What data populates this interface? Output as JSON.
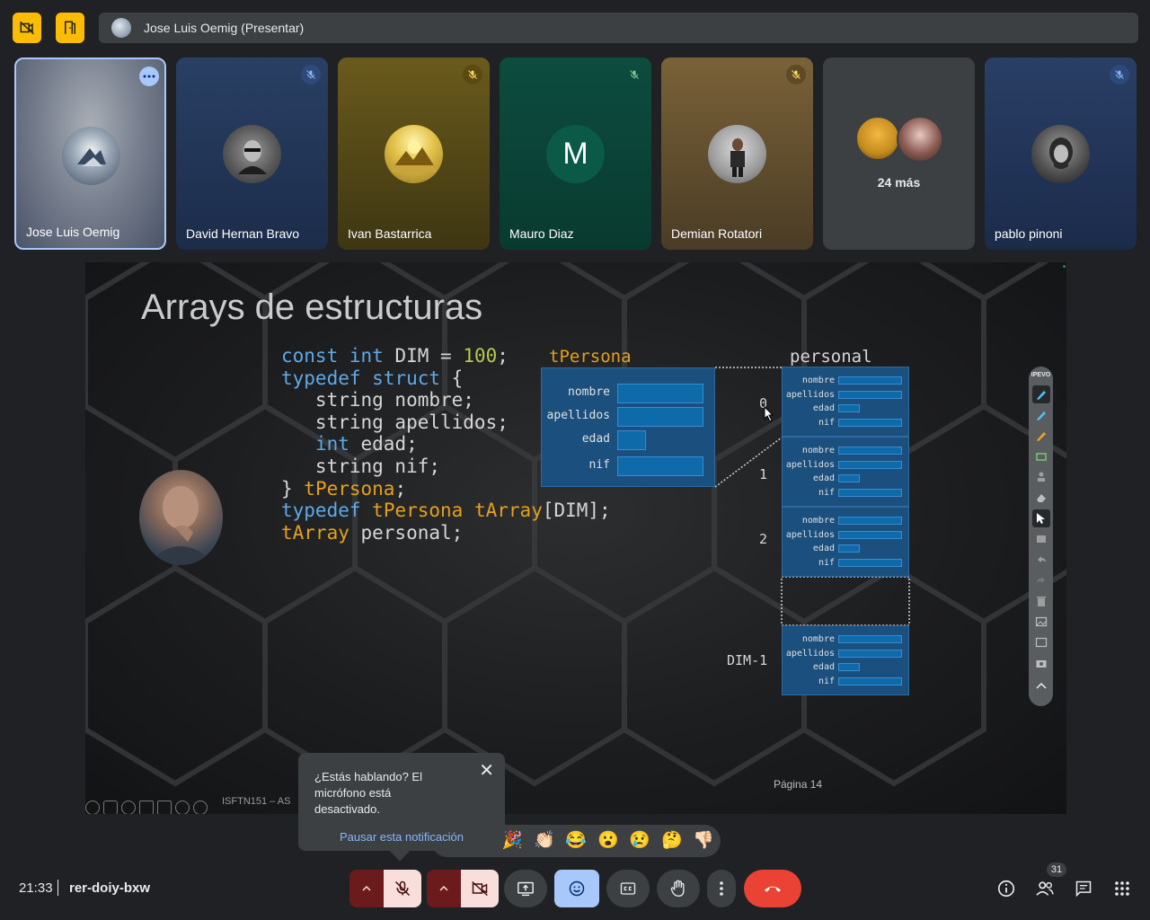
{
  "presenter_bar": {
    "label": "Jose Luis Oemig (Presentar)"
  },
  "tiles": [
    {
      "name": "Jose Luis Oemig"
    },
    {
      "name": "David Hernan Bravo"
    },
    {
      "name": "Ivan Bastarrica"
    },
    {
      "name": "Mauro Diaz",
      "initial": "M"
    },
    {
      "name": "Demian Rotatori"
    },
    {
      "more": "24 más"
    },
    {
      "name": "pablo pinoni"
    }
  ],
  "slide": {
    "title": "Arrays de estructuras",
    "code": {
      "l1_kw1": "const",
      "l1_kw2": "int",
      "l1_text": " DIM = ",
      "l1_num": "100",
      "l1_end": ";",
      "l2_kw1": "typedef",
      "l2_kw2": "struct",
      "l2_text": " {",
      "l3": "   string nombre;",
      "l4": "   string apellidos;",
      "l5_kw": "int",
      "l5_text": " edad;",
      "l6": "   string nif;",
      "l7_text": "} ",
      "l7_ty": "tPersona",
      "l7_end": ";",
      "l8_kw": "typedef",
      "l8_ty1": "tPersona",
      "l8_ty2": "tArray",
      "l8_text": "[DIM];",
      "l9_ty": "tArray",
      "l9_text": " personal;"
    },
    "struct_title": "tPersona",
    "array_title": "personal",
    "fields": [
      "nombre",
      "apellidos",
      "edad",
      "nif"
    ],
    "indices": [
      "0",
      "1",
      "2",
      "DIM-1"
    ],
    "page_label": "Página 14",
    "footer": "ISFTN151 – AS"
  },
  "ipevo": {
    "header": "IPEVO"
  },
  "toast": {
    "message": "¿Estás hablando? El micrófono está desactivado.",
    "action": "Pausar esta notificación",
    "close": "✕"
  },
  "reactions": [
    "🎉",
    "👏🏻",
    "😂",
    "😮",
    "😢",
    "🤔",
    "👎🏻"
  ],
  "bottom": {
    "time": "21:33",
    "meeting_code": "rer-doiy-bxw",
    "people_count": "31"
  },
  "colors": {
    "accent": "#8ab4f8",
    "danger": "#ea4335",
    "warning": "#fbbc04"
  }
}
